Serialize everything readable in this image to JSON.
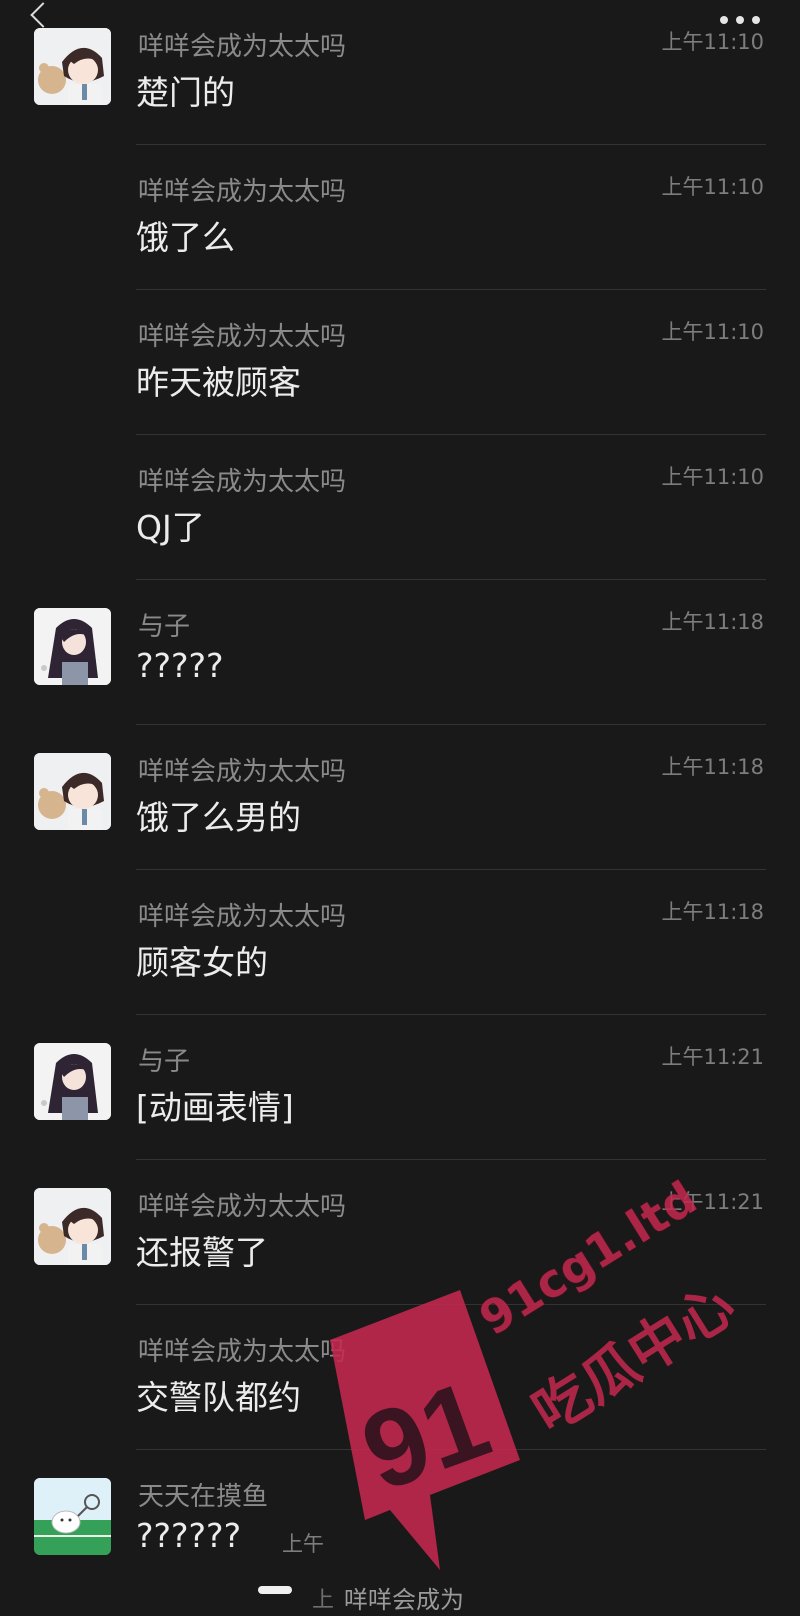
{
  "header": {
    "back_icon": "chevron-left-icon",
    "more_icon": "more-dots-icon"
  },
  "messages": [
    {
      "name": "咩咩会成为太太吗",
      "time": "上午11:10",
      "text": "楚门的",
      "avatar": "boy"
    },
    {
      "name": "咩咩会成为太太吗",
      "time": "上午11:10",
      "text": "饿了么",
      "avatar": ""
    },
    {
      "name": "咩咩会成为太太吗",
      "time": "上午11:10",
      "text": "昨天被顾客",
      "avatar": ""
    },
    {
      "name": "咩咩会成为太太吗",
      "time": "上午11:10",
      "text": "QJ了",
      "avatar": ""
    },
    {
      "name": "与子",
      "time": "上午11:18",
      "text": "?????",
      "avatar": "girl"
    },
    {
      "name": "咩咩会成为太太吗",
      "time": "上午11:18",
      "text": "饿了么男的",
      "avatar": "boy"
    },
    {
      "name": "咩咩会成为太太吗",
      "time": "上午11:18",
      "text": "顾客女的",
      "avatar": ""
    },
    {
      "name": "与子",
      "time": "上午11:21",
      "text": "[动画表情]",
      "avatar": "girl"
    },
    {
      "name": "咩咩会成为太太吗",
      "time": "上午11:21",
      "text": "还报警了",
      "avatar": "boy"
    },
    {
      "name": "咩咩会成为太太吗",
      "time": "",
      "text": "交警队都约",
      "avatar": ""
    },
    {
      "name": "天天在摸鱼",
      "time": "",
      "text": "??????",
      "avatar": "fish"
    }
  ],
  "footer": {
    "peek_time": "上",
    "peek_name": "咩咩会成为",
    "peek_time_row11": "上午"
  },
  "watermark": {
    "number": "91",
    "domain": "91cg1.ltd",
    "slogan": "吃瓜中心"
  }
}
